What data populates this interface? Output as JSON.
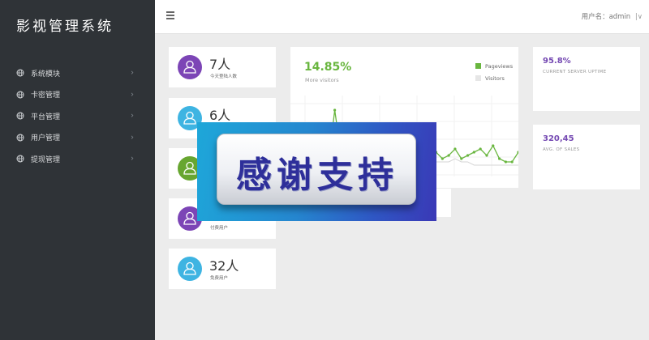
{
  "app": {
    "title": "影视管理系统"
  },
  "sidebar": {
    "items": [
      {
        "label": "系统模块",
        "icon": "globe-icon"
      },
      {
        "label": "卡密管理",
        "icon": "globe-icon"
      },
      {
        "label": "平台管理",
        "icon": "globe-icon"
      },
      {
        "label": "用户管理",
        "icon": "globe-icon"
      },
      {
        "label": "提现管理",
        "icon": "globe-icon"
      }
    ]
  },
  "topbar": {
    "menu_icon": "hamburger-icon",
    "user_label": "用户名：admin",
    "caret": "|∨"
  },
  "stats": [
    {
      "value": "7人",
      "label": "今天登陆人数",
      "color": "#7c45b6"
    },
    {
      "value": "6人",
      "label": "",
      "color": "#3eb4e2"
    },
    {
      "value": "",
      "label": "",
      "color": "#67a630"
    },
    {
      "value": "",
      "label": "付费用户",
      "color": "#7c45b6"
    },
    {
      "value": "32人",
      "label": "免费用户",
      "color": "#3eb4e2"
    }
  ],
  "chart": {
    "percent": "14.85%",
    "subtitle": "More visitors",
    "legend": [
      {
        "name": "Pageviews",
        "color": "#69b63f"
      },
      {
        "name": "Visitors",
        "color": "#e6e6e6"
      }
    ]
  },
  "chart_data": {
    "type": "line",
    "title": "",
    "xlabel": "",
    "ylabel": "",
    "series": [
      {
        "name": "Pageviews",
        "values": [
          2,
          3,
          1,
          6,
          2,
          3,
          2,
          18,
          4,
          6,
          2,
          5,
          3,
          6,
          5,
          4,
          3,
          5,
          4,
          2,
          3,
          6,
          4,
          5,
          3,
          4,
          6,
          3,
          4,
          5,
          6,
          4,
          7,
          3,
          2,
          2,
          5
        ]
      },
      {
        "name": "Visitors",
        "values": [
          1,
          2,
          1,
          3,
          1,
          2,
          1,
          4,
          2,
          3,
          1,
          2,
          2,
          3,
          2,
          2,
          1,
          2,
          2,
          1,
          2,
          3,
          2,
          2,
          2,
          2,
          3,
          2,
          2,
          1,
          1,
          1,
          1,
          1,
          1,
          1,
          1
        ]
      }
    ],
    "ylim": [
      0,
      20
    ],
    "grid": true,
    "legend_position": "top-right"
  },
  "info_cards": [
    {
      "value": "95.8%",
      "caption": "CURRENT SERVER UPTIME"
    },
    {
      "value": "320,45",
      "caption": "AVG. OF SALES"
    }
  ],
  "banner": {
    "text": "感谢支持"
  }
}
